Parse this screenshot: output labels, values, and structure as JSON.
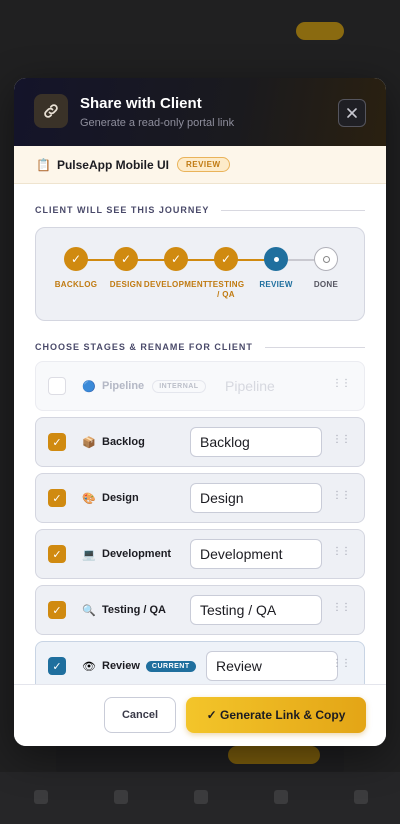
{
  "modal": {
    "title": "Share with Client",
    "subtitle": "Generate a read-only portal link"
  },
  "project": {
    "emoji": "📋",
    "name": "PulseApp Mobile UI",
    "badge": "REVIEW"
  },
  "journey": {
    "section_title": "CLIENT WILL SEE THIS JOURNEY",
    "steps": [
      {
        "label": "BACKLOG",
        "state": "done",
        "mark": "✓"
      },
      {
        "label": "DESIGN",
        "state": "done",
        "mark": "✓"
      },
      {
        "label": "DEVELOPMENT",
        "state": "done",
        "mark": "✓"
      },
      {
        "label": "TESTING / QA",
        "state": "done",
        "mark": "✓"
      },
      {
        "label": "REVIEW",
        "state": "current",
        "mark": ""
      },
      {
        "label": "DONE",
        "state": "todo",
        "mark": ""
      }
    ]
  },
  "stages": {
    "section_title": "CHOOSE STAGES & RENAME FOR CLIENT",
    "items": [
      {
        "name": "Pipeline",
        "icon": "🔵",
        "badge": "INTERNAL",
        "value": "Pipeline",
        "checked": false
      },
      {
        "name": "Backlog",
        "icon": "📦",
        "badge": "",
        "value": "Backlog",
        "checked": true
      },
      {
        "name": "Design",
        "icon": "🎨",
        "badge": "",
        "value": "Design",
        "checked": true
      },
      {
        "name": "Development",
        "icon": "💻",
        "badge": "",
        "value": "Development",
        "checked": true
      },
      {
        "name": "Testing / QA",
        "icon": "🔍",
        "badge": "",
        "value": "Testing / QA",
        "checked": true
      },
      {
        "name": "Review",
        "icon": "👁",
        "badge": "CURRENT",
        "value": "Review",
        "checked": true
      }
    ]
  },
  "footer": {
    "cancel_label": "Cancel",
    "generate_label": "✓ Generate Link & Copy"
  },
  "colors": {
    "accent": "#d08a10",
    "current": "#1f6f9e"
  }
}
